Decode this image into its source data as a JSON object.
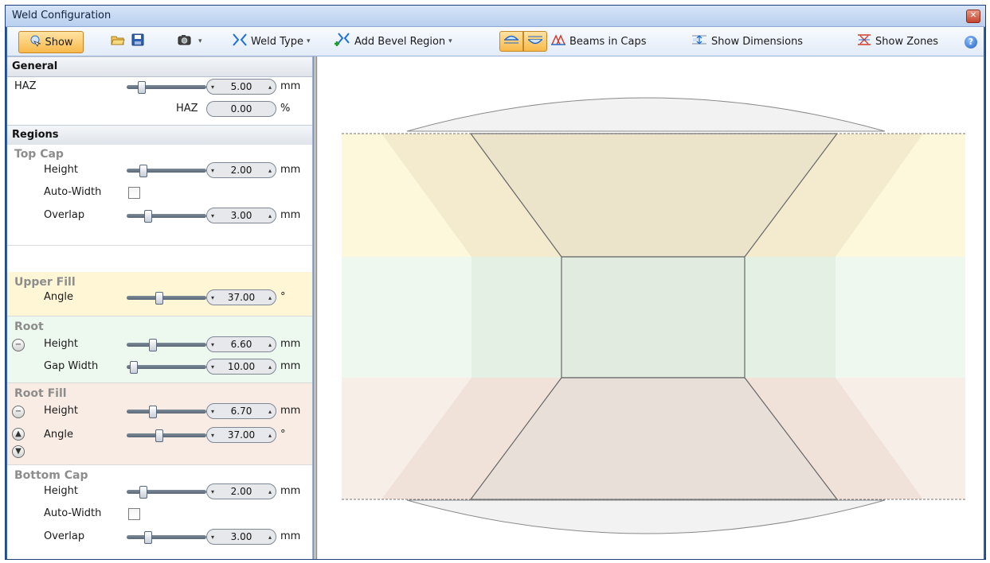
{
  "window": {
    "title": "Weld Configuration"
  },
  "toolbar": {
    "show_label": "Show",
    "weld_type_label": "Weld Type",
    "add_bevel_label": "Add Bevel Region",
    "beams_in_caps_label": "Beams in Caps",
    "show_dimensions_label": "Show Dimensions",
    "show_zones_label": "Show Zones"
  },
  "general": {
    "header": "General",
    "haz_label": "HAZ",
    "haz_value": "5.00",
    "haz_unit": "mm",
    "haz_pct_label": "HAZ",
    "haz_pct_value": "0.00",
    "haz_pct_unit": "%"
  },
  "regions": {
    "header": "Regions",
    "top_cap": {
      "title": "Top Cap",
      "height_label": "Height",
      "height_value": "2.00",
      "height_unit": "mm",
      "auto_width_label": "Auto-Width",
      "overlap_label": "Overlap",
      "overlap_value": "3.00",
      "overlap_unit": "mm"
    },
    "upper_fill": {
      "title": "Upper Fill",
      "angle_label": "Angle",
      "angle_value": "37.00",
      "angle_unit": "°"
    },
    "root": {
      "title": "Root",
      "height_label": "Height",
      "height_value": "6.60",
      "height_unit": "mm",
      "gap_label": "Gap Width",
      "gap_value": "10.00",
      "gap_unit": "mm"
    },
    "root_fill": {
      "title": "Root Fill",
      "height_label": "Height",
      "height_value": "6.70",
      "height_unit": "mm",
      "angle_label": "Angle",
      "angle_value": "37.00",
      "angle_unit": "°"
    },
    "bottom_cap": {
      "title": "Bottom Cap",
      "height_label": "Height",
      "height_value": "2.00",
      "height_unit": "mm",
      "auto_width_label": "Auto-Width",
      "overlap_label": "Overlap",
      "overlap_value": "3.00",
      "overlap_unit": "mm"
    }
  },
  "colors": {
    "upper_zone": "#fdf8dc",
    "root_zone": "#eef8ef",
    "lower_zone": "#f8eee8",
    "upper_fill_bg": "#fff6d5",
    "root_bg": "#edf8ee",
    "root_fill_bg": "#f8ece4",
    "accent": "#f8b94a"
  },
  "icons": [
    "show-icon",
    "open-icon",
    "save-icon",
    "camera-icon",
    "weld-type-icon",
    "add-bevel-icon",
    "cap-top-icon",
    "cap-bottom-icon",
    "beams-icon",
    "dimensions-icon",
    "zones-icon",
    "help-icon"
  ]
}
